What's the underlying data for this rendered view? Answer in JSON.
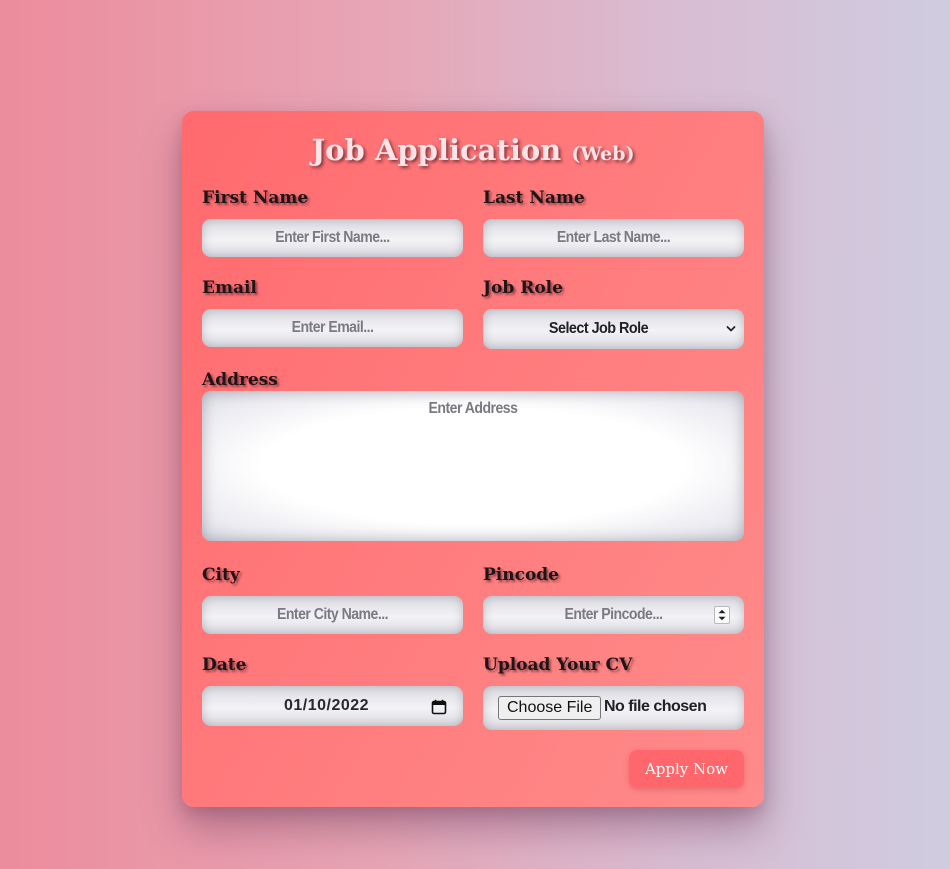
{
  "form": {
    "title": "Job Application",
    "title_suffix": "(Web)",
    "first_name": {
      "label": "First Name",
      "placeholder": "Enter First Name..."
    },
    "last_name": {
      "label": "Last Name",
      "placeholder": "Enter Last Name..."
    },
    "email": {
      "label": "Email",
      "placeholder": "Enter Email..."
    },
    "job_role": {
      "label": "Job Role",
      "selected": "Select Job Role"
    },
    "address": {
      "label": "Address",
      "placeholder": "Enter Address"
    },
    "city": {
      "label": "City",
      "placeholder": "Enter City Name..."
    },
    "pincode": {
      "label": "Pincode",
      "placeholder": "Enter Pincode..."
    },
    "date": {
      "label": "Date",
      "value": "01/10/2022"
    },
    "cv": {
      "label": "Upload Your CV",
      "button": "Choose File",
      "status": "No file chosen"
    },
    "submit_label": "Apply Now"
  },
  "colors": {
    "card": "#ff7375",
    "button": "#ff676d",
    "label": "#1f1416"
  },
  "icons": {
    "select": "chevron-down-icon",
    "date": "calendar-icon",
    "number": "spinner-icon"
  }
}
